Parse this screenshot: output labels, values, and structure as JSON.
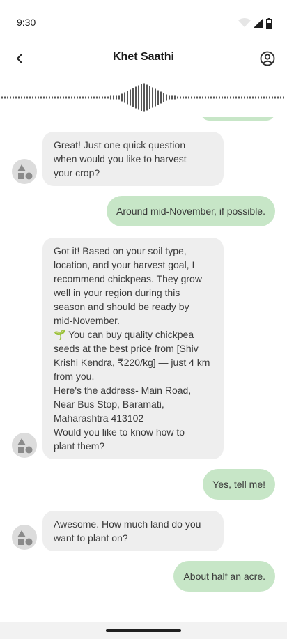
{
  "status_bar": {
    "time": "9:30"
  },
  "app_bar": {
    "title": "Khet Saathi",
    "back_icon": "chevron-left-icon",
    "profile_icon": "account-circle-icon"
  },
  "colors": {
    "bot_bubble": "#eeeeee",
    "user_bubble": "#c7e6c7",
    "avatar": "#dcdcdc"
  },
  "messages": [
    {
      "sender": "bot",
      "text": "Great! Just one quick question —\nwhen would you like to harvest\nyour crop?"
    },
    {
      "sender": "user",
      "text": "Around mid-November, if possible."
    },
    {
      "sender": "bot",
      "text": "Got it! Based on your soil type,\nlocation, and your harvest goal, I\nrecommend chickpeas. They grow\nwell in your region during this\nseason and should be ready by\nmid-November.\n🌱 You can buy quality chickpea\nseeds at the best price from [Shiv\nKrishi Kendra, ₹220/kg] — just 4 km\nfrom you.\nHere's the address- Main Road,\nNear Bus Stop, Baramati,\nMaharashtra 413102\nWould you like to know how to\nplant them?"
    },
    {
      "sender": "user",
      "text": "Yes, tell me!"
    },
    {
      "sender": "bot",
      "text": "Awesome. How much land do you\nwant to plant on?"
    },
    {
      "sender": "user",
      "text": "About half an acre."
    }
  ]
}
